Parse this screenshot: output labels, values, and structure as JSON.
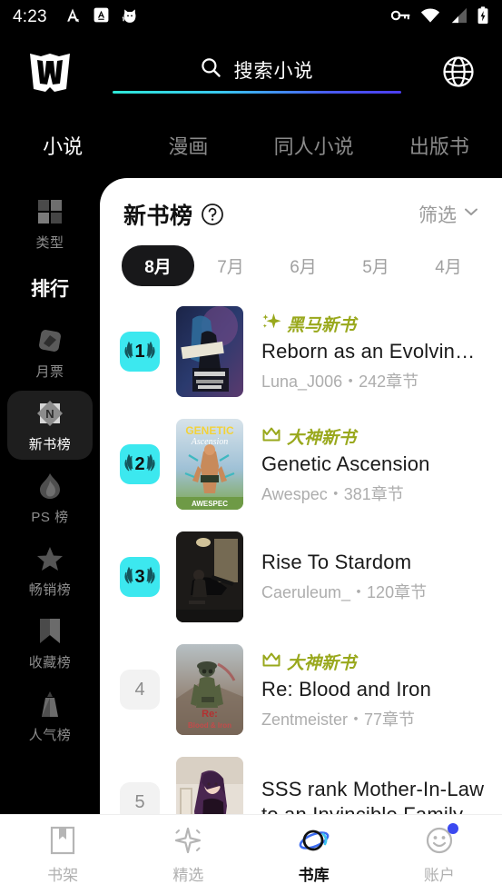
{
  "statusbar": {
    "time": "4:23",
    "left_icons": [
      "autofill-a-icon",
      "app-a-icon",
      "cat-app-icon"
    ],
    "right_icons": [
      "vpn-key-icon",
      "wifi-icon",
      "cellular-signal-icon",
      "battery-charging-icon"
    ]
  },
  "header": {
    "logo": "webnovel-w-logo",
    "search": {
      "placeholder": "搜索小说",
      "icon": "search-icon"
    },
    "language_icon": "globe-icon",
    "underline_gradient_from": "#2ee8d8",
    "underline_gradient_to": "#4b3df0"
  },
  "tabs": [
    {
      "label": "小说",
      "active": true
    },
    {
      "label": "漫画",
      "active": false
    },
    {
      "label": "同人小说",
      "active": false
    },
    {
      "label": "出版书",
      "active": false
    }
  ],
  "sidebar": {
    "category": {
      "label": "类型",
      "icon": "grid-icon"
    },
    "section_title": "排行",
    "items": [
      {
        "label": "月票",
        "icon": "diamond-ticket-icon",
        "selected": false
      },
      {
        "label": "新书榜",
        "icon": "new-badge-icon",
        "selected": true
      },
      {
        "label": "PS 榜",
        "icon": "flame-icon",
        "selected": false
      },
      {
        "label": "畅销榜",
        "icon": "star-icon",
        "selected": false
      },
      {
        "label": "收藏榜",
        "icon": "bookmark-icon",
        "selected": false
      },
      {
        "label": "人气榜",
        "icon": "trophy-icon",
        "selected": false
      }
    ]
  },
  "panel": {
    "title": "新书榜",
    "help_icon": "question-circle-icon",
    "filter_label": "筛选",
    "filter_icon": "chevron-down-icon",
    "months": [
      {
        "label": "8月",
        "active": true
      },
      {
        "label": "7月",
        "active": false
      },
      {
        "label": "6月",
        "active": false
      },
      {
        "label": "5月",
        "active": false
      },
      {
        "label": "4月",
        "active": false
      }
    ],
    "books": [
      {
        "rank": "1",
        "rank_style": "top",
        "tag": "黑马新书",
        "tag_icon": "sparkle-icon",
        "title": "Reborn as an Evolving ...",
        "author": "Luna_J006",
        "chapters": "242章节",
        "meta": "Luna_J006・242章节",
        "cover": "cyberpunk-woman-cover"
      },
      {
        "rank": "2",
        "rank_style": "top",
        "tag": "大神新书",
        "tag_icon": "crown-icon",
        "title": "Genetic Ascension",
        "author": "Awespec",
        "chapters": "381章节",
        "meta": "Awespec・381章节",
        "cover": "genetic-ascension-cover"
      },
      {
        "rank": "3",
        "rank_style": "top",
        "tag": "",
        "tag_icon": "",
        "title": "Rise To Stardom",
        "author": "Caeruleum_",
        "chapters": "120章节",
        "meta": "Caeruleum_・120章节",
        "cover": "pianist-cover"
      },
      {
        "rank": "4",
        "rank_style": "plain",
        "tag": "大神新书",
        "tag_icon": "crown-icon",
        "title": "Re: Blood and Iron",
        "author": "Zentmeister",
        "chapters": "77章节",
        "meta": "Zentmeister・77章节",
        "cover": "soldier-cover"
      },
      {
        "rank": "5",
        "rank_style": "plain",
        "tag": "",
        "tag_icon": "",
        "title": "SSS rank Mother-In-Law to an Invincible Family",
        "author": "",
        "chapters": "",
        "meta": "",
        "cover": "purple-hair-woman-cover"
      }
    ]
  },
  "bottomnav": [
    {
      "label": "书架",
      "icon": "bookshelf-icon",
      "active": false,
      "badge": false
    },
    {
      "label": "精选",
      "icon": "sparkle-icon",
      "active": false,
      "badge": false
    },
    {
      "label": "书库",
      "icon": "library-planet-icon",
      "active": true,
      "badge": false
    },
    {
      "label": "账户",
      "icon": "account-smiley-icon",
      "active": false,
      "badge": true
    }
  ],
  "colors": {
    "accent_cyan": "#3ce8ef",
    "accent_blue": "#3b49f0",
    "tag_olive": "#99a81c",
    "panel_bg": "#ffffff",
    "app_bg": "#000000"
  }
}
